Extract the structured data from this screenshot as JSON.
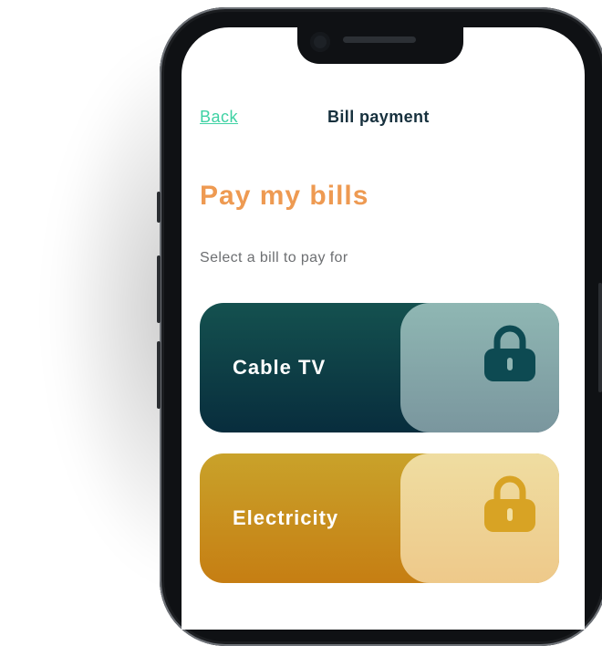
{
  "header": {
    "back_label": "Back",
    "title": "Bill payment"
  },
  "page": {
    "heading": "Pay my bills",
    "subtitle": "Select a bill to pay for"
  },
  "bills": [
    {
      "label": "Cable TV",
      "icon": "lock-icon",
      "color": "#0b3a45"
    },
    {
      "label": "Electricity",
      "icon": "lock-icon",
      "color": "#c78e1c"
    }
  ],
  "colors": {
    "accent": "#3fd2a4",
    "heading": "#ee9a52",
    "title": "#16303d"
  }
}
